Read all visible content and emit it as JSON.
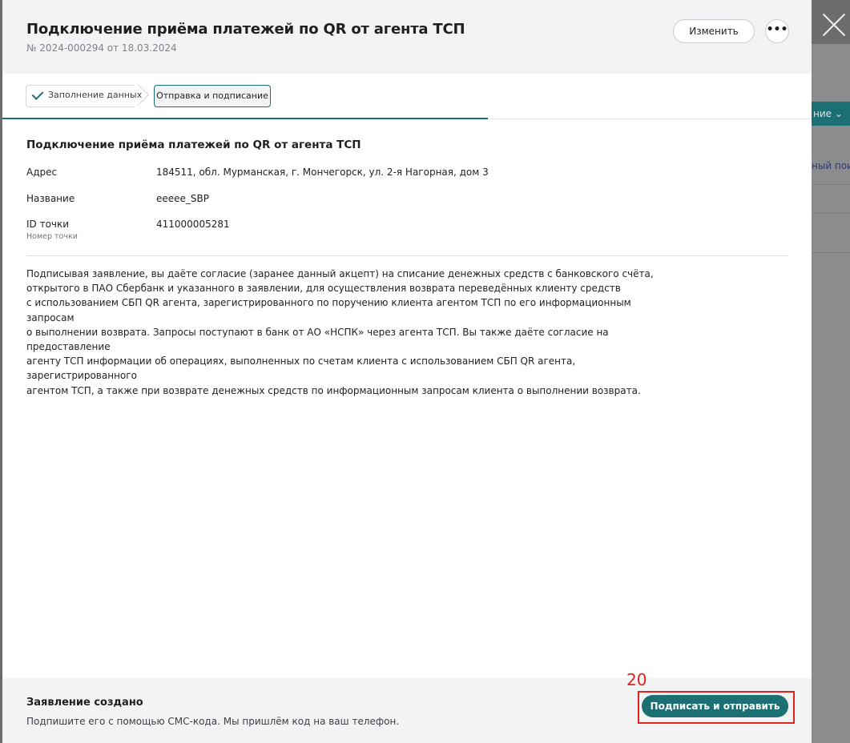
{
  "background": {
    "teal_button_fragment": "ние",
    "link_fragment": "ный пои"
  },
  "header": {
    "title": "Подключение приёма платежей по QR от агента ТСП",
    "subtitle": "№ 2024-000294 от 18.03.2024",
    "edit_label": "Изменить",
    "more_label": "•••"
  },
  "steps": [
    {
      "label": "Заполнение данных",
      "state": "done"
    },
    {
      "label": "Отправка и подписание",
      "state": "active"
    }
  ],
  "details": {
    "section_title": "Подключение приёма платежей по QR от агента ТСП",
    "fields": [
      {
        "label": "Адрес",
        "value": "184511, обл. Мурманская, г. Мончегорск, ул. 2-я Нагорная, дом 3"
      },
      {
        "label": "Название",
        "value": "eeeee_SBP"
      },
      {
        "label": "ID точки",
        "hint": "Номер точки",
        "value": "411000005281"
      }
    ]
  },
  "consent_lines": [
    "Подписывая заявление, вы даёте согласие (заранее данный акцепт) на списание денежных средств с банковского счёта,",
    "открытого в ПАО Сбербанк и указанного в заявлении, для осуществления возврата переведённых клиенту средств",
    "с использованием СБП QR агента, зарегистрированного по поручению клиента агентом ТСП по его информационным запросам",
    "о выполнении возврата. Запросы поступают в банк от АО «НСПК» через агента ТСП. Вы также даёте согласие на предоставление",
    "агенту ТСП информации об операциях, выполненных по счетам клиента с использованием СБП QR агента, зарегистрированного",
    "агентом ТСП, а также при возврате денежных средств по информационным запросам клиента о выполнении возврата."
  ],
  "footer": {
    "title": "Заявление создано",
    "text": "Подпишите его с помощью СМС-кода. Мы пришлём код на ваш телефон.",
    "sign_label": "Подписать и отправить",
    "annotation_number": "20"
  },
  "colors": {
    "accent": "#1c6f73",
    "annotation": "#e0221c"
  }
}
